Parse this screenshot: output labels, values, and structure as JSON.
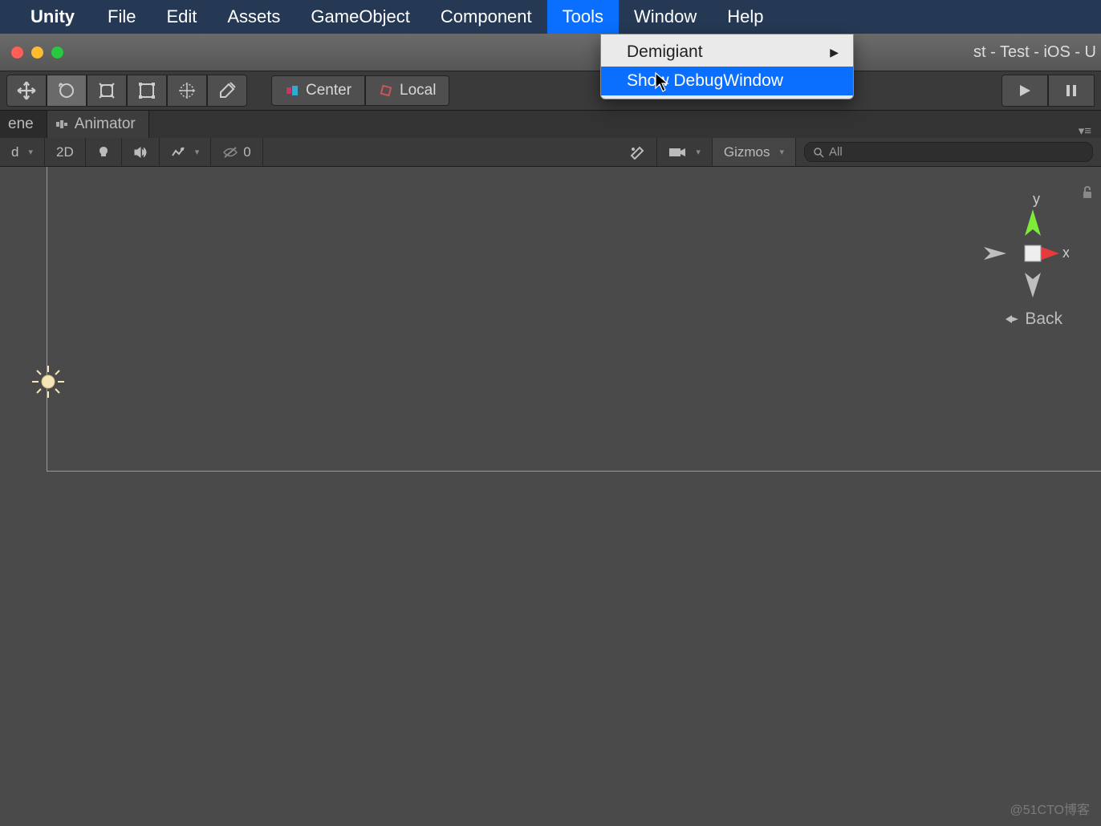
{
  "menubar": {
    "app": "Unity",
    "items": [
      "File",
      "Edit",
      "Assets",
      "GameObject",
      "Component",
      "Tools",
      "Window",
      "Help"
    ],
    "selected": "Tools"
  },
  "dropdown": {
    "items": [
      {
        "label": "Demigiant",
        "submenu": true,
        "highlight": false
      },
      {
        "label": "Show DebugWindow",
        "submenu": false,
        "highlight": true
      }
    ]
  },
  "window_title": "st - Test - iOS - U",
  "toolbar": {
    "center_label": "Center",
    "local_label": "Local"
  },
  "tabs": {
    "scene": "ene",
    "animator": "Animator"
  },
  "subbar": {
    "shaded": "d",
    "twod": "2D",
    "hidden_count": "0",
    "gizmos": "Gizmos",
    "search_placeholder": "All"
  },
  "gizmo": {
    "y": "y",
    "x": "x",
    "back": "Back"
  },
  "watermark": "@51CTO博客"
}
